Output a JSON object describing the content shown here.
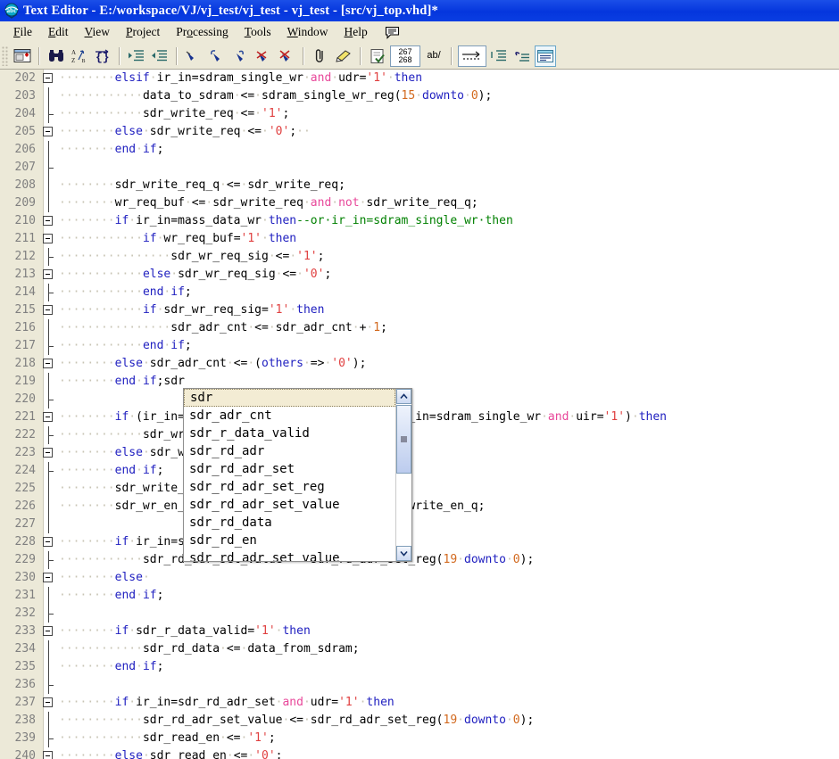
{
  "window": {
    "title": "Text Editor - E:/workspace/VJ/vj_test/vj_test - vj_test - [src/vj_top.vhd]*",
    "app_icon": "abc-spellcheck-icon"
  },
  "menubar": {
    "items": [
      {
        "label": "File",
        "accel": "F"
      },
      {
        "label": "Edit",
        "accel": "E"
      },
      {
        "label": "View",
        "accel": "V"
      },
      {
        "label": "Project",
        "accel": "P"
      },
      {
        "label": "Processing",
        "accel": "o"
      },
      {
        "label": "Tools",
        "accel": "T"
      },
      {
        "label": "Window",
        "accel": "W"
      },
      {
        "label": "Help",
        "accel": "H"
      }
    ],
    "bubble_icon": "speech-bubble-icon"
  },
  "toolbar": {
    "buttons": [
      {
        "name": "open-project-icon",
        "label": ""
      },
      {
        "name": "find-binoculars-icon",
        "label": ""
      },
      {
        "name": "sort-az-icon",
        "label": ""
      },
      {
        "name": "braces-match-icon",
        "label": ""
      },
      {
        "name": "increase-indent-icon",
        "label": ""
      },
      {
        "name": "decrease-indent-icon",
        "label": ""
      },
      {
        "name": "bookmark-toggle-icon",
        "label": ""
      },
      {
        "name": "bookmark-next-icon",
        "label": ""
      },
      {
        "name": "bookmark-prev-icon",
        "label": ""
      },
      {
        "name": "bookmark-clear-icon",
        "label": ""
      },
      {
        "name": "bookmark-clear-all-icon",
        "label": ""
      },
      {
        "name": "attach-paperclip-icon",
        "label": ""
      },
      {
        "name": "highlighter-icon",
        "label": ""
      },
      {
        "name": "check-document-icon",
        "label": ""
      },
      {
        "name": "line-counter-icon",
        "label": "267\n268"
      },
      {
        "name": "word-wrap-icon",
        "label": "ab/"
      },
      {
        "name": "show-tabs-icon",
        "label": ""
      },
      {
        "name": "insert-template-icon",
        "label": ""
      },
      {
        "name": "undo-indent-icon",
        "label": ""
      },
      {
        "name": "toggle-panel-icon",
        "label": ""
      }
    ],
    "line_counter_top": "267",
    "line_counter_bottom": "268",
    "word_wrap_label": "ab/"
  },
  "editor": {
    "language": "vhdl",
    "show_whitespace_dots": true,
    "first_line": 202,
    "lines": [
      {
        "num": "202",
        "fold": "box",
        "text": "········elsif·ir_in=sdram_single_wr·and·udr='1'·then"
      },
      {
        "num": "203",
        "fold": "line",
        "text": "············data_to_sdram·<=·sdram_single_wr_reg(15·downto·0);"
      },
      {
        "num": "204",
        "fold": "tick",
        "text": "············sdr_write_req·<=·'1';"
      },
      {
        "num": "205",
        "fold": "box",
        "text": "········else·sdr_write_req·<=·'0';··"
      },
      {
        "num": "206",
        "fold": "line",
        "text": "········end·if;"
      },
      {
        "num": "207",
        "fold": "tick",
        "text": ""
      },
      {
        "num": "208",
        "fold": "line",
        "text": "········sdr_write_req_q·<=·sdr_write_req;"
      },
      {
        "num": "209",
        "fold": "line",
        "text": "········wr_req_buf·<=·sdr_write_req·and·not·sdr_write_req_q;"
      },
      {
        "num": "210",
        "fold": "box",
        "text": "········if·ir_in=mass_data_wr·then--or·ir_in=sdram_single_wr·then"
      },
      {
        "num": "211",
        "fold": "box",
        "text": "············if·wr_req_buf='1'·then"
      },
      {
        "num": "212",
        "fold": "tick",
        "text": "················sdr_wr_req_sig·<=·'1';"
      },
      {
        "num": "213",
        "fold": "box",
        "text": "············else·sdr_wr_req_sig·<=·'0';"
      },
      {
        "num": "214",
        "fold": "tick",
        "text": "············end·if;"
      },
      {
        "num": "215",
        "fold": "box",
        "text": "············if·sdr_wr_req_sig='1'·then"
      },
      {
        "num": "216",
        "fold": "line",
        "text": "················sdr_adr_cnt·<=·sdr_adr_cnt·+·1;"
      },
      {
        "num": "217",
        "fold": "tick",
        "text": "············end·if;"
      },
      {
        "num": "218",
        "fold": "box",
        "text": "········else·sdr_adr_cnt·<=·(others·=>·'0');"
      },
      {
        "num": "219",
        "fold": "line",
        "text": "········end·if;sdr"
      },
      {
        "num": "220",
        "fold": "tick",
        "text": ""
      },
      {
        "num": "221",
        "fold": "box",
        "text": "········if·(ir_in=mass_data_wr·and·udr='1')·or·(ir_in=sdram_single_wr·and·uir='1')·then"
      },
      {
        "num": "222",
        "fold": "tick",
        "text": "············sdr_write_en·<=·'1';"
      },
      {
        "num": "223",
        "fold": "box",
        "text": "········else·sdr_write_en·<=·'0';"
      },
      {
        "num": "224",
        "fold": "tick",
        "text": "········end·if;"
      },
      {
        "num": "225",
        "fold": "line",
        "text": "········sdr_write_en_q·<=·sdr_write_en;"
      },
      {
        "num": "226",
        "fold": "line",
        "text": "········sdr_wr_en_sig·<=·sdr_write_en·and·not·sdr_write_en_q;"
      },
      {
        "num": "227",
        "fold": "line",
        "text": ""
      },
      {
        "num": "228",
        "fold": "box",
        "text": "········if·ir_in=sdr_rd_adr_set·and·udr='1'·then"
      },
      {
        "num": "229",
        "fold": "tick",
        "text": "············sdr_rd_adr_set_value·<=·sdr_rd_adr_set_reg(19·downto·0);"
      },
      {
        "num": "230",
        "fold": "box",
        "text": "········else·"
      },
      {
        "num": "231",
        "fold": "line",
        "text": "········end·if;"
      },
      {
        "num": "232",
        "fold": "tick",
        "text": ""
      },
      {
        "num": "233",
        "fold": "box",
        "text": "········if·sdr_r_data_valid='1'·then"
      },
      {
        "num": "234",
        "fold": "line",
        "text": "············sdr_rd_data·<=·data_from_sdram;"
      },
      {
        "num": "235",
        "fold": "line",
        "text": "········end·if;"
      },
      {
        "num": "236",
        "fold": "tick",
        "text": ""
      },
      {
        "num": "237",
        "fold": "box",
        "text": "········if·ir_in=sdr_rd_adr_set·and·udr='1'·then"
      },
      {
        "num": "238",
        "fold": "line",
        "text": "············sdr_rd_adr_set_value·<=·sdr_rd_adr_set_reg(19·downto·0);"
      },
      {
        "num": "239",
        "fold": "tick",
        "text": "············sdr_read_en·<=·'1';"
      },
      {
        "num": "240",
        "fold": "box",
        "text": "········else·sdr_read_en·<=·'0';"
      }
    ]
  },
  "autocomplete": {
    "visible": true,
    "selected_index": 0,
    "items": [
      "sdr",
      "sdr_adr_cnt",
      "sdr_r_data_valid",
      "sdr_rd_adr",
      "sdr_rd_adr_set",
      "sdr_rd_adr_set_reg",
      "sdr_rd_adr_set_value",
      "sdr_rd_data",
      "sdr_rd_en",
      "sdr_rd_adr_set_value"
    ],
    "scroll_up_icon": "chevron-up-icon",
    "scroll_down_icon": "chevron-down-icon"
  },
  "colors": {
    "titlebar": "#0a3ee2",
    "chrome": "#ece9d8",
    "keyword": "#2020c0",
    "operator_word": "#e8489a",
    "literal": "#d2691e",
    "string_literal": "#e04040",
    "comment": "#008000",
    "whitespace_dot": "#c8c4b4",
    "selection": "#f3ecd4"
  }
}
